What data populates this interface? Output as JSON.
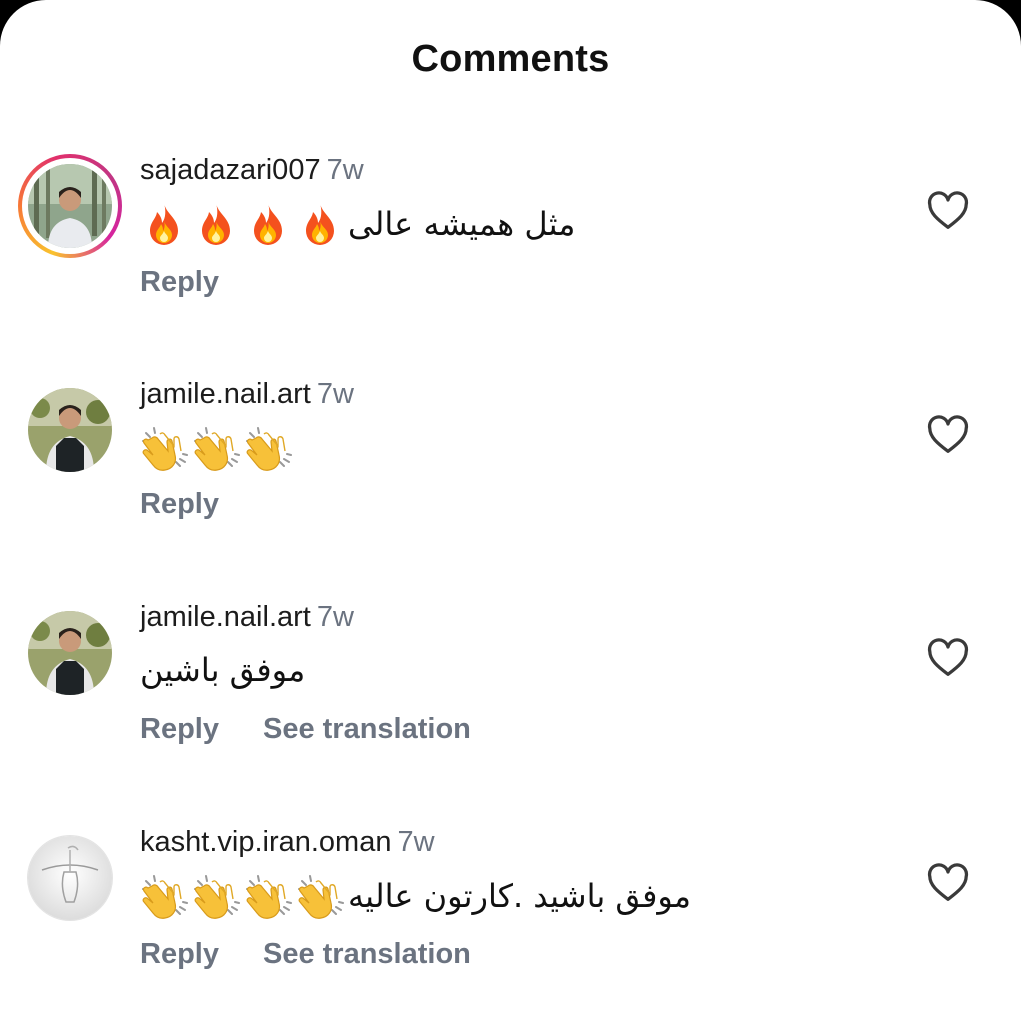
{
  "header": {
    "title": "Comments"
  },
  "actions": {
    "reply": "Reply",
    "see_translation": "See translation"
  },
  "icons": {
    "like": "heart-outline-icon",
    "fire": "fire-emoji",
    "clap": "clapping-hands-emoji"
  },
  "colors": {
    "text": "#1c1c1c",
    "muted": "#6b7380",
    "story_ring": [
      "#f9c22e",
      "#f77737",
      "#e1306c",
      "#c13584"
    ]
  },
  "comments": [
    {
      "username": "sajadazari007",
      "time": "7w",
      "text": "مثل همیشه عالی",
      "emoji": "fire",
      "emoji_count": 4,
      "has_translation": false,
      "story_ring": true
    },
    {
      "username": "jamile.nail.art",
      "time": "7w",
      "text": "",
      "emoji": "clap",
      "emoji_count": 3,
      "has_translation": false,
      "story_ring": false
    },
    {
      "username": "jamile.nail.art",
      "time": "7w",
      "text": "موفق باشین",
      "emoji": "",
      "emoji_count": 0,
      "has_translation": true,
      "story_ring": false
    },
    {
      "username": "kasht.vip.iran.oman",
      "time": "7w",
      "text": "موفق باشید .کارتون عالیه",
      "emoji": "clap",
      "emoji_count": 4,
      "has_translation": true,
      "story_ring": false
    }
  ]
}
